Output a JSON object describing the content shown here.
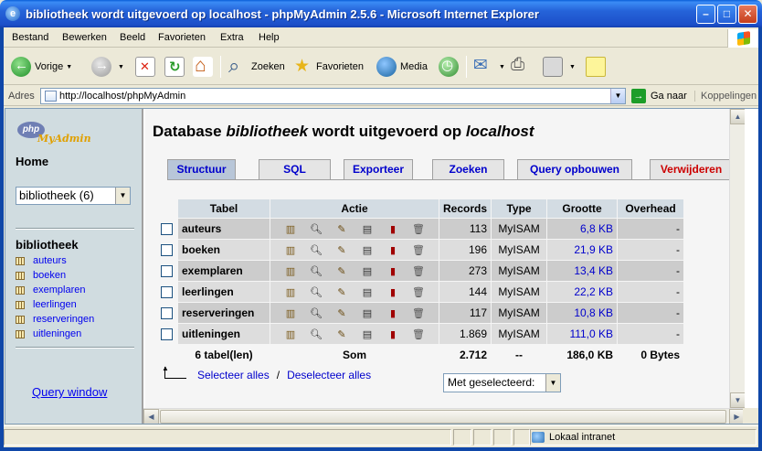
{
  "window": {
    "title": "bibliotheek wordt uitgevoerd op localhost - phpMyAdmin 2.5.6 - Microsoft Internet Explorer",
    "minimize": "–",
    "maximize": "□",
    "close": "✕"
  },
  "menu": [
    "Bestand",
    "Bewerken",
    "Beeld",
    "Favorieten",
    "Extra",
    "Help"
  ],
  "toolbar": {
    "back": "Vorige",
    "search": "Zoeken",
    "favorites": "Favorieten",
    "media": "Media"
  },
  "address": {
    "label": "Adres",
    "url": "http://localhost/phpMyAdmin",
    "go": "Ga naar",
    "links": "Koppelingen"
  },
  "left": {
    "logo_php": "php",
    "logo_my": "MyAdmin",
    "home": "Home",
    "db_select": "bibliotheek (6)",
    "db_name": "bibliotheek",
    "tables": [
      "auteurs",
      "boeken",
      "exemplaren",
      "leerlingen",
      "reserveringen",
      "uitleningen"
    ],
    "query_window": "Query window"
  },
  "main": {
    "title_prefix": "Database ",
    "title_db": "bibliotheek",
    "title_mid": " wordt uitgevoerd op ",
    "title_host": "localhost",
    "tabs": [
      "Structuur",
      "SQL",
      "Exporteer",
      "Zoeken",
      "Query opbouwen",
      "Verwijderen"
    ],
    "columns": {
      "table": "Tabel",
      "action": "Actie",
      "records": "Records",
      "type": "Type",
      "size": "Grootte",
      "overhead": "Overhead"
    },
    "rows": [
      {
        "name": "auteurs",
        "records": "113",
        "type": "MyISAM",
        "size": "6,8 KB",
        "overhead": "-"
      },
      {
        "name": "boeken",
        "records": "196",
        "type": "MyISAM",
        "size": "21,9 KB",
        "overhead": "-"
      },
      {
        "name": "exemplaren",
        "records": "273",
        "type": "MyISAM",
        "size": "13,4 KB",
        "overhead": "-"
      },
      {
        "name": "leerlingen",
        "records": "144",
        "type": "MyISAM",
        "size": "22,2 KB",
        "overhead": "-"
      },
      {
        "name": "reserveringen",
        "records": "117",
        "type": "MyISAM",
        "size": "10,8 KB",
        "overhead": "-"
      },
      {
        "name": "uitleningen",
        "records": "1.869",
        "type": "MyISAM",
        "size": "111,0 KB",
        "overhead": "-"
      }
    ],
    "footer": {
      "tables": "6 tabel(len)",
      "sum": "Som",
      "records": "2.712",
      "type": "--",
      "size": "186,0 KB",
      "overhead": "0 Bytes"
    },
    "select_all": "Selecteer alles",
    "separator": "/",
    "deselect_all": "Deselecteer alles",
    "with_selected": "Met geselecteerd:"
  },
  "status": {
    "zone": "Lokaal intranet"
  },
  "colors": {
    "titlebar": "#2563d9",
    "header_cell": "#d3dce3",
    "row_odd": "#cccccc",
    "row_even": "#dddddd",
    "link": "#0000cc",
    "danger_tab": "#cc0000"
  }
}
